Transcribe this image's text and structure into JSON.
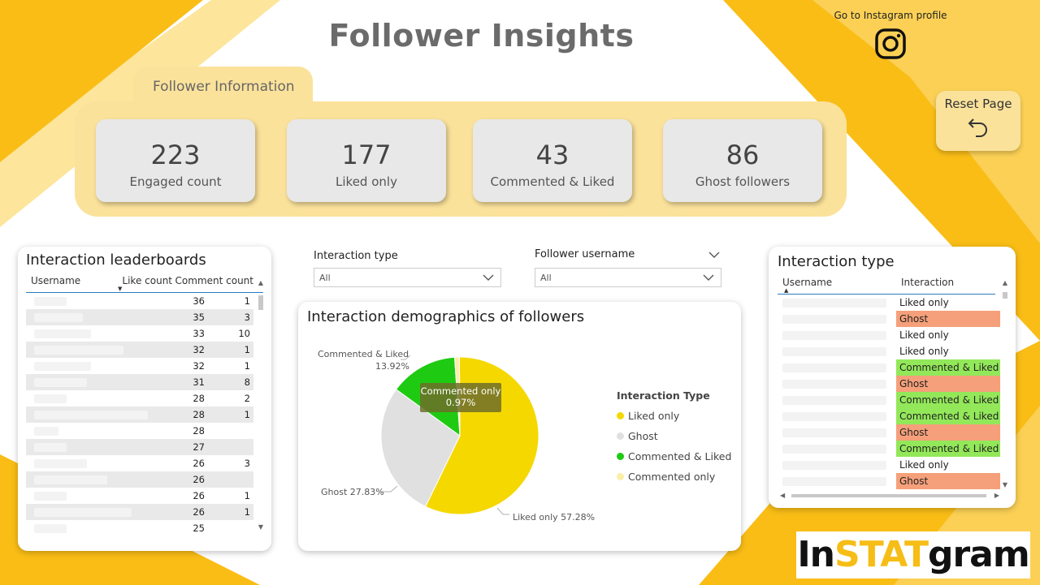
{
  "page": {
    "title": "Follower Insights"
  },
  "instagram_link": {
    "label": "Go to Instagram profile",
    "icon": "instagram-icon"
  },
  "reset_button": {
    "label": "Reset Page",
    "icon": "undo-icon"
  },
  "follower_info": {
    "tab_label": "Follower Information",
    "cards": [
      {
        "value": "223",
        "label": "Engaged count"
      },
      {
        "value": "177",
        "label": "Liked only"
      },
      {
        "value": "43",
        "label": "Commented & Liked"
      },
      {
        "value": "86",
        "label": "Ghost followers"
      }
    ]
  },
  "leaderboard": {
    "title": "Interaction leaderboards",
    "columns": [
      "Username",
      "Like count",
      "Comment count"
    ],
    "rows": [
      {
        "likes": "36",
        "comments": "1"
      },
      {
        "likes": "35",
        "comments": "3"
      },
      {
        "likes": "33",
        "comments": "10"
      },
      {
        "likes": "32",
        "comments": "1"
      },
      {
        "likes": "32",
        "comments": "1"
      },
      {
        "likes": "31",
        "comments": "8"
      },
      {
        "likes": "28",
        "comments": "2"
      },
      {
        "likes": "28",
        "comments": "1"
      },
      {
        "likes": "28",
        "comments": ""
      },
      {
        "likes": "27",
        "comments": ""
      },
      {
        "likes": "26",
        "comments": "3"
      },
      {
        "likes": "26",
        "comments": ""
      },
      {
        "likes": "26",
        "comments": "1"
      },
      {
        "likes": "26",
        "comments": "1"
      },
      {
        "likes": "25",
        "comments": ""
      }
    ]
  },
  "slicers": {
    "interaction_type": {
      "label": "Interaction type",
      "value": "All"
    },
    "follower_username": {
      "label": "Follower username",
      "value": "All"
    }
  },
  "pie_chart": {
    "title": "Interaction demographics of followers",
    "legend_title": "Interaction Type",
    "tooltip": {
      "label": "Commented only",
      "value": "0.97%"
    },
    "slice_labels": {
      "commented_liked": "Commented & Liked",
      "commented_liked_pct": "13.92%",
      "ghost": "Ghost 27.83%",
      "liked_only": "Liked only 57.28%"
    }
  },
  "chart_data": {
    "type": "pie",
    "title": "Interaction demographics of followers",
    "legend_title": "Interaction Type",
    "legend_placement": "right",
    "slices": [
      {
        "name": "Liked only",
        "value": 57.28,
        "color": "#f5d800"
      },
      {
        "name": "Ghost",
        "value": 27.83,
        "color": "#e0e0e0"
      },
      {
        "name": "Commented & Liked",
        "value": 13.92,
        "color": "#1fca12"
      },
      {
        "name": "Commented only",
        "value": 0.97,
        "color": "#fbeea6"
      }
    ]
  },
  "interaction_table": {
    "title": "Interaction type",
    "columns": [
      "Username",
      "Interaction"
    ],
    "rows": [
      {
        "interaction": "Liked only",
        "kind": "liked"
      },
      {
        "interaction": "Ghost",
        "kind": "ghost"
      },
      {
        "interaction": "Liked only",
        "kind": "liked"
      },
      {
        "interaction": "Liked only",
        "kind": "liked"
      },
      {
        "interaction": "Commented & Liked",
        "kind": "cl"
      },
      {
        "interaction": "Ghost",
        "kind": "ghost"
      },
      {
        "interaction": "Commented & Liked",
        "kind": "cl"
      },
      {
        "interaction": "Commented & Liked",
        "kind": "cl"
      },
      {
        "interaction": "Ghost",
        "kind": "ghost"
      },
      {
        "interaction": "Commented & Liked",
        "kind": "cl"
      },
      {
        "interaction": "Liked only",
        "kind": "liked"
      },
      {
        "interaction": "Ghost",
        "kind": "ghost"
      }
    ]
  },
  "brand": {
    "prefix": "In",
    "highlight": "STAT",
    "suffix": "gram",
    "accent": "#f6bd16"
  },
  "colors": {
    "primary_yellow": "#f9bd16",
    "light_yellow": "#fbe29b",
    "card_grey": "#e8e8e8"
  }
}
